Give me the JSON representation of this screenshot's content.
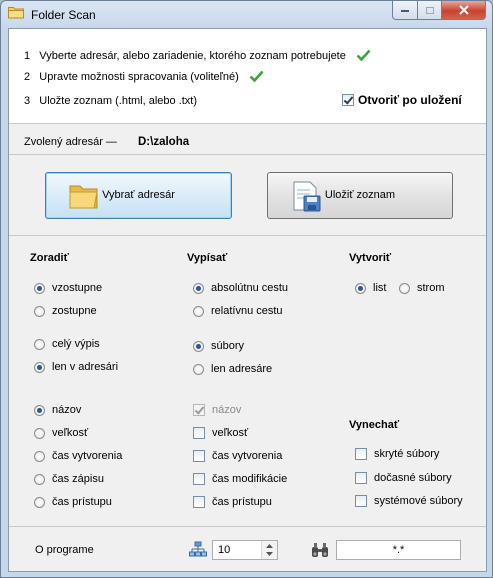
{
  "window": {
    "title": "Folder Scan",
    "icons": {
      "app": "folder-icon",
      "minimize": "minimize-icon",
      "maximize": "maximize-icon",
      "close": "close-icon"
    }
  },
  "steps": [
    {
      "num": "1",
      "text": "Vyberte adresár, alebo zariadenie, ktorého zoznam potrebujete",
      "done": true
    },
    {
      "num": "2",
      "text": "Upravte možnosti spracovania (voliteľné)",
      "done": true
    },
    {
      "num": "3",
      "text": "Uložte zoznam (.html, alebo .txt)",
      "done": false
    }
  ],
  "open_after_save": {
    "label": "Otvoriť po uložení",
    "checked": true
  },
  "directory": {
    "label": "Zvolený adresár —",
    "value": "D:\\zaloha"
  },
  "buttons": {
    "select_dir": {
      "label": "Vybrať adresár",
      "icon": "folder-icon"
    },
    "save_list": {
      "label": "Uložiť zoznam",
      "icon": "save-document-icon"
    }
  },
  "sort": {
    "header": "Zoradiť",
    "order": [
      {
        "label": "vzostupne",
        "checked": true
      },
      {
        "label": "zostupne",
        "checked": false
      }
    ],
    "scope": [
      {
        "label": "celý výpis",
        "checked": false
      },
      {
        "label": "len v adresári",
        "checked": true
      }
    ],
    "by": [
      {
        "label": "názov",
        "checked": true
      },
      {
        "label": "veľkosť",
        "checked": false
      },
      {
        "label": "čas vytvorenia",
        "checked": false
      },
      {
        "label": "čas zápisu",
        "checked": false
      },
      {
        "label": "čas prístupu",
        "checked": false
      }
    ]
  },
  "print": {
    "header": "Vypísať",
    "path": [
      {
        "label": "absolútnu cestu",
        "checked": true
      },
      {
        "label": "relatívnu cestu",
        "checked": false
      }
    ],
    "items": [
      {
        "label": "súbory",
        "checked": true
      },
      {
        "label": "len adresáre",
        "checked": false
      }
    ],
    "columns": [
      {
        "label": "názov",
        "checked": true,
        "disabled": true
      },
      {
        "label": "veľkosť",
        "checked": false
      },
      {
        "label": "čas vytvorenia",
        "checked": false
      },
      {
        "label": "čas modifikácie",
        "checked": false
      },
      {
        "label": "čas prístupu",
        "checked": false
      }
    ]
  },
  "create": {
    "header": "Vytvoriť",
    "options": [
      {
        "label": "list",
        "checked": true
      },
      {
        "label": "strom",
        "checked": false
      }
    ]
  },
  "skip": {
    "header": "Vynechať",
    "options": [
      {
        "label": "skryté súbory",
        "checked": false
      },
      {
        "label": "dočasné súbory",
        "checked": false
      },
      {
        "label": "systémové súbory",
        "checked": false
      }
    ]
  },
  "footer": {
    "about": "O programe",
    "depth_icon": "tree-depth-icon",
    "depth_value": "10",
    "filter_icon": "binoculars-icon",
    "filter_value": "*.*"
  },
  "colors": {
    "check_green": "#3aa43a",
    "focus_blue": "#3c7fb1",
    "close_red": "#c7432f"
  }
}
